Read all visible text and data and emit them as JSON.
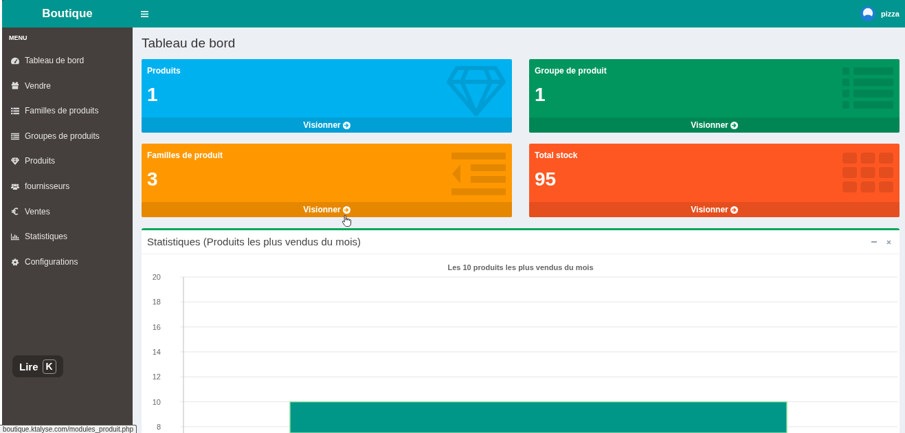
{
  "app": {
    "brand": "Boutique",
    "user": {
      "name": "pizza"
    }
  },
  "sidebar": {
    "header": "MENU",
    "items": [
      {
        "label": "Tableau de bord"
      },
      {
        "label": "Vendre"
      },
      {
        "label": "Familles de produits"
      },
      {
        "label": "Groupes de produits"
      },
      {
        "label": "Produits"
      },
      {
        "label": "fournisseurs"
      },
      {
        "label": "Ventes"
      },
      {
        "label": "Statistiques"
      },
      {
        "label": "Configurations"
      }
    ]
  },
  "page": {
    "title": "Tableau de bord"
  },
  "cards": [
    {
      "label": "Produits",
      "value": "1",
      "link": "Visionner",
      "color": "#00b1ef"
    },
    {
      "label": "Groupe de produit",
      "value": "1",
      "link": "Visionner",
      "color": "#00965e"
    },
    {
      "label": "Familles de produit",
      "value": "3",
      "link": "Visionner",
      "color": "#ff9800"
    },
    {
      "label": "Total stock",
      "value": "95",
      "link": "Visionner",
      "color": "#ff5722"
    }
  ],
  "stats_box": {
    "title": "Statistiques (Produits les plus vendus du mois)",
    "chart_data": {
      "type": "bar",
      "title": "Les 10 produits les plus vendus du mois",
      "values": [
        10
      ],
      "ylim": [
        7.5,
        20
      ],
      "yticks": [
        8,
        10,
        12,
        14,
        16,
        18,
        20
      ],
      "grid": true
    }
  },
  "player_hint": {
    "label": "Lire",
    "key": "K"
  },
  "status_url": "boutique.ktalyse.com/modules_produit.php"
}
